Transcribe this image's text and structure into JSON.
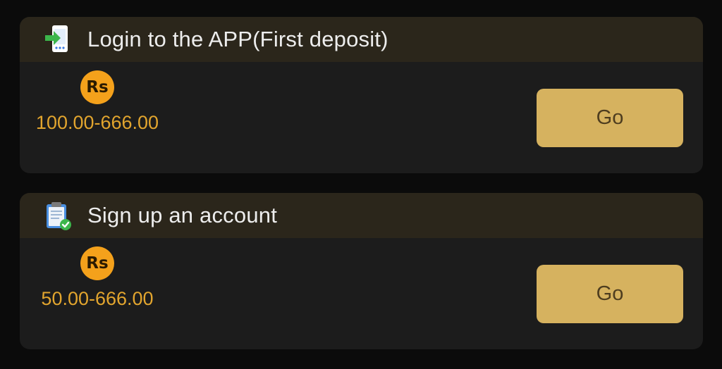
{
  "tasks": [
    {
      "title": "Login to the APP(First deposit)",
      "icon": "phone-login-icon",
      "currency_symbol": "Rs",
      "amount": "100.00-666.00",
      "button_label": "Go"
    },
    {
      "title": "Sign up an account",
      "icon": "clipboard-check-icon",
      "currency_symbol": "Rs",
      "amount": "50.00-666.00",
      "button_label": "Go"
    }
  ],
  "colors": {
    "page_bg": "#0b0b0b",
    "card_bg": "#1c1c1c",
    "header_bg": "#2b261b",
    "accent_gold": "#d6b25f",
    "amount_text": "#e2a52e",
    "coin": "#f4a11b"
  }
}
